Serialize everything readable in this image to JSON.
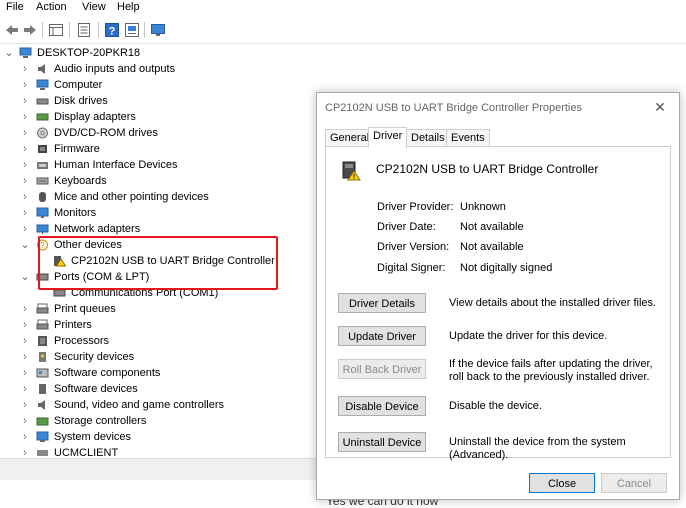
{
  "menubar": {
    "items": [
      "File",
      "Action",
      "View",
      "Help"
    ]
  },
  "toolbar": {
    "buttons": [
      "back-arrow-icon",
      "forward-arrow-icon",
      "properties-grid-icon",
      "list-view-icon",
      "help-icon",
      "monitor-icon"
    ]
  },
  "tree": {
    "root": "DESKTOP-20PKR18",
    "items": [
      {
        "label": "Audio inputs and outputs",
        "icon": "speaker-icon"
      },
      {
        "label": "Computer",
        "icon": "computer-icon"
      },
      {
        "label": "Disk drives",
        "icon": "disk-drive-icon"
      },
      {
        "label": "Display adapters",
        "icon": "display-adapter-icon"
      },
      {
        "label": "DVD/CD-ROM drives",
        "icon": "dvd-icon"
      },
      {
        "label": "Firmware",
        "icon": "firmware-icon"
      },
      {
        "label": "Human Interface Devices",
        "icon": "hid-icon"
      },
      {
        "label": "Keyboards",
        "icon": "keyboard-icon"
      },
      {
        "label": "Mice and other pointing devices",
        "icon": "mouse-icon"
      },
      {
        "label": "Monitors",
        "icon": "monitor-icon"
      },
      {
        "label": "Network adapters",
        "icon": "network-icon"
      },
      {
        "label": "Other devices",
        "icon": "other-devices-icon"
      },
      {
        "label": "CP2102N USB to UART Bridge Controller",
        "icon": "warning-device-icon"
      },
      {
        "label": "Ports (COM & LPT)",
        "icon": "ports-icon"
      },
      {
        "label": "Communications Port (COM1)",
        "icon": "port-icon"
      },
      {
        "label": "Print queues",
        "icon": "printer-icon"
      },
      {
        "label": "Printers",
        "icon": "printer-icon"
      },
      {
        "label": "Processors",
        "icon": "processor-icon"
      },
      {
        "label": "Security devices",
        "icon": "security-icon"
      },
      {
        "label": "Software components",
        "icon": "software-component-icon"
      },
      {
        "label": "Software devices",
        "icon": "software-device-icon"
      },
      {
        "label": "Sound, video and game controllers",
        "icon": "sound-icon"
      },
      {
        "label": "Storage controllers",
        "icon": "storage-icon"
      },
      {
        "label": "System devices",
        "icon": "system-icon"
      },
      {
        "label": "UCMCLIENT",
        "icon": "usb-icon"
      }
    ]
  },
  "dialog": {
    "title": "CP2102N USB to UART Bridge Controller Properties",
    "close_glyph": "✕",
    "tabs": [
      "General",
      "Driver",
      "Details",
      "Events"
    ],
    "active_tab": "Driver",
    "device_name": "CP2102N USB to UART Bridge Controller",
    "fields": [
      {
        "label": "Driver Provider:",
        "value": "Unknown"
      },
      {
        "label": "Driver Date:",
        "value": "Not available"
      },
      {
        "label": "Driver Version:",
        "value": "Not available"
      },
      {
        "label": "Digital Signer:",
        "value": "Not digitally signed"
      }
    ],
    "actions": [
      {
        "button": "Driver Details",
        "desc": "View details about the installed driver files.",
        "disabled": false
      },
      {
        "button": "Update Driver",
        "desc": "Update the driver for this device.",
        "disabled": false
      },
      {
        "button": "Roll Back Driver",
        "desc": "If the device fails after updating the driver, roll back to the previously installed driver.",
        "disabled": true
      },
      {
        "button": "Disable Device",
        "desc": "Disable the device.",
        "disabled": false
      },
      {
        "button": "Uninstall Device",
        "desc": "Uninstall the device from the system (Advanced).",
        "disabled": false
      }
    ],
    "close_label": "Close",
    "cancel_label": "Cancel"
  },
  "background_text": "Yes we can do it now",
  "colors": {
    "highlight": "#e2191c",
    "accent": "#0078d7"
  }
}
